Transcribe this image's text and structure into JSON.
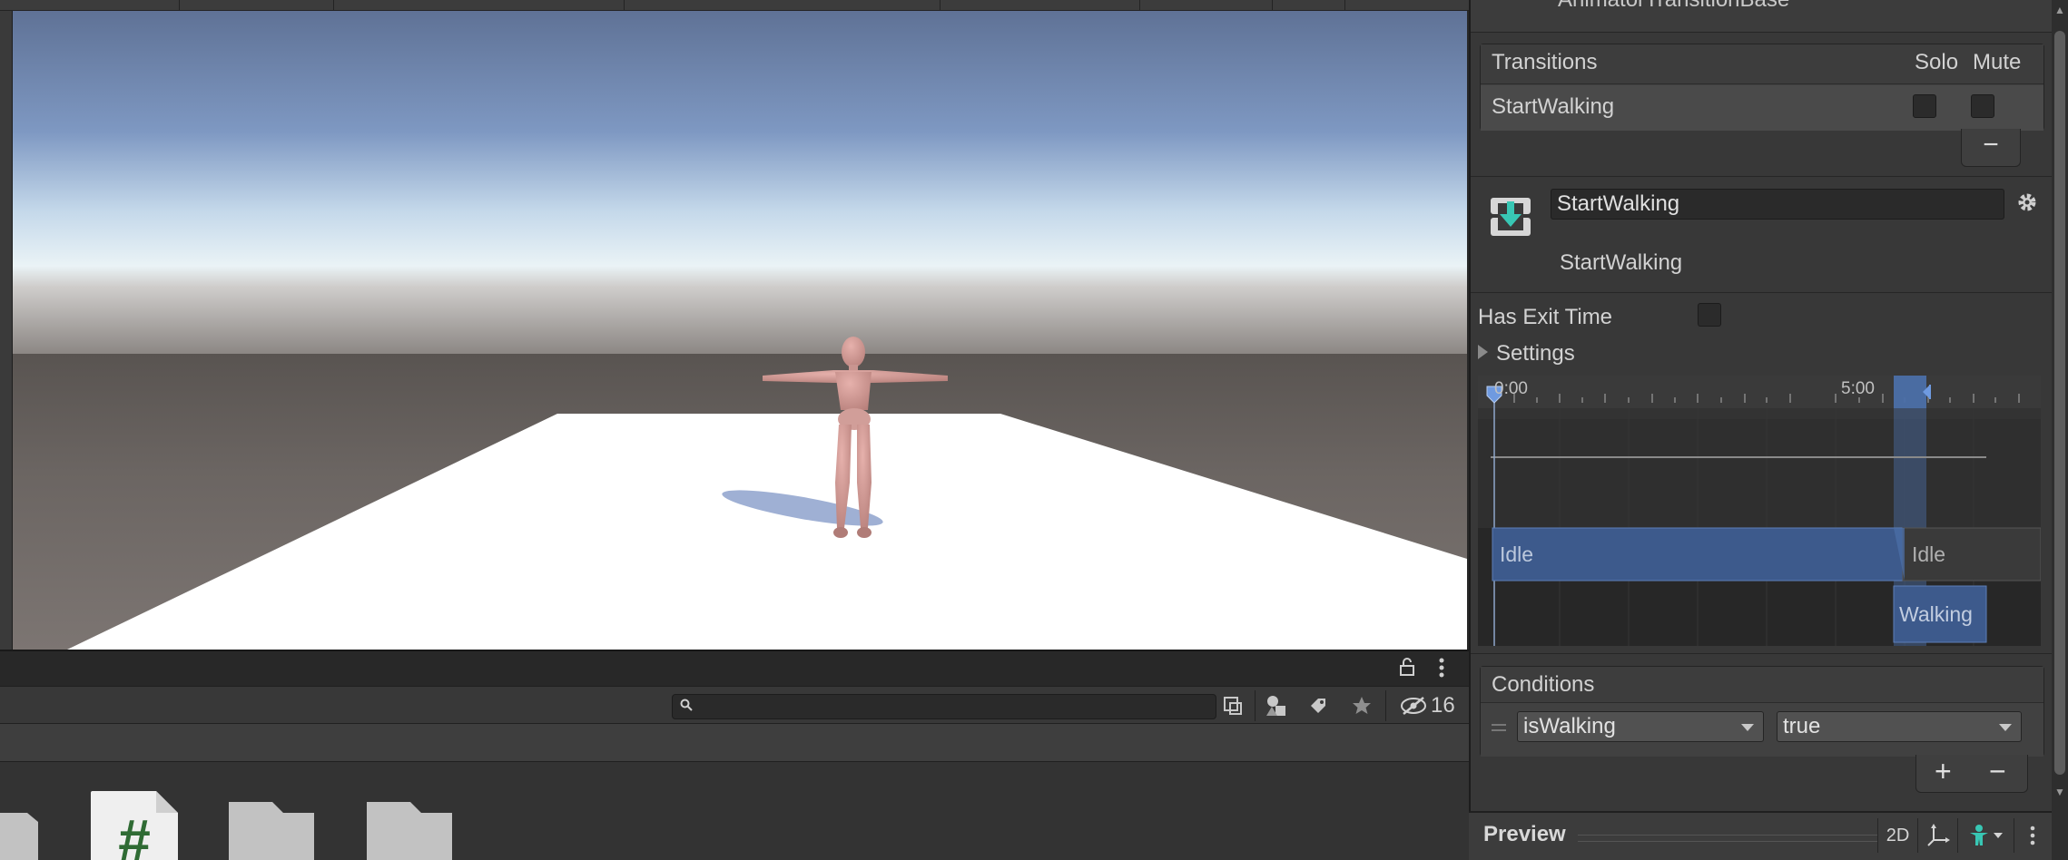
{
  "inspector": {
    "component_title": "AnimatorTransitionBase",
    "transitions_header": "Transitions",
    "solo_label": "Solo",
    "mute_label": "Mute",
    "transition_row_name": "StartWalking",
    "minus_label": "−",
    "transition_name_value": "StartWalking",
    "transition_subtitle": "StartWalking",
    "has_exit_time_label": "Has Exit Time",
    "settings_label": "Settings",
    "conditions_header": "Conditions",
    "condition_parameter": "isWalking",
    "condition_value": "true",
    "plus_label": "+",
    "minus2_label": "−",
    "preview_label": "Preview",
    "preview_2d_label": "2D"
  },
  "timeline": {
    "tick_start": "0:00",
    "tick_mid": "5:00",
    "clip_idle_1": "Idle",
    "clip_idle_2": "Idle",
    "clip_walking": "Walking"
  },
  "project": {
    "hidden_count": "16",
    "search_placeholder": ""
  },
  "icons": {
    "transition_icon": "transition-download-icon",
    "gear": "gear-icon",
    "lock": "lock-icon",
    "kebab": "kebab-menu-icon",
    "search": "search-icon",
    "script_file": "csharp-script-icon",
    "folder": "folder-icon"
  },
  "colors": {
    "clip_blue": "#3d5a8c",
    "transition_highlight": "#4b6fa8",
    "accent_teal": "#38c7b4"
  }
}
